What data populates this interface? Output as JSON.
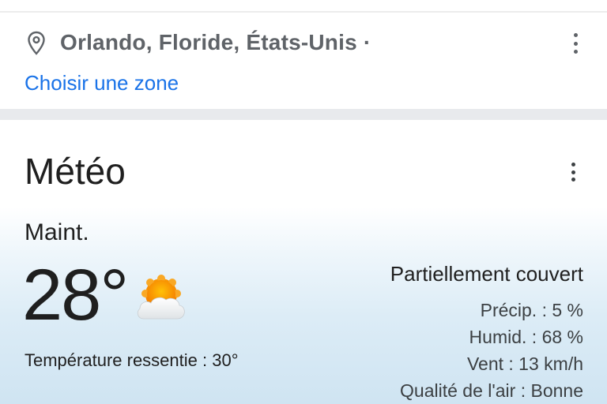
{
  "location": {
    "text": "Orlando, Floride, États-Unis ·",
    "choose_zone_link": "Choisir une zone",
    "pin_icon": "map-pin-icon",
    "menu_icon": "more-vert-icon"
  },
  "weather": {
    "title": "Météo",
    "menu_icon": "more-vert-icon",
    "now_label": "Maint.",
    "temperature": "28°",
    "condition_icon": "partly-cloudy-icon",
    "feels_like": "Température ressentie : 30°",
    "condition": "Partiellement couvert",
    "precip": "Précip. : 5 %",
    "humidity": "Humid. : 68 %",
    "wind": "Vent : 13 km/h",
    "air_quality": "Qualité de l'air : Bonne"
  },
  "colors": {
    "link": "#1a73e8",
    "location_text": "#5f6368",
    "separator": "#e8eaed",
    "sun": "#f9a825",
    "cloud": "#f1f3f4"
  }
}
